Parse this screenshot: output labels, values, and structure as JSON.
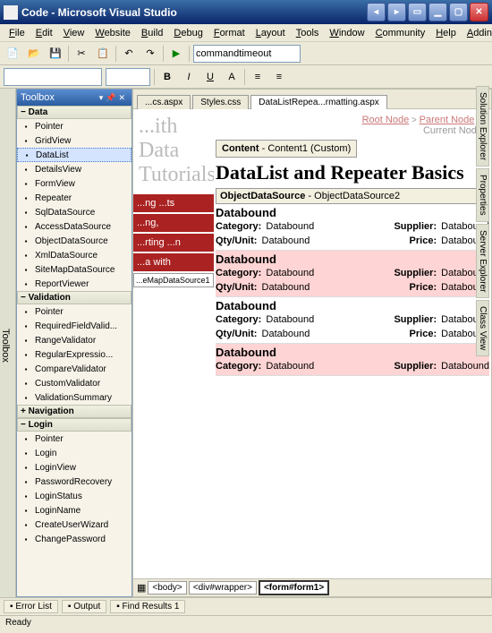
{
  "window": {
    "title": "Code - Microsoft Visual Studio",
    "min": "▁",
    "max": "▢",
    "close": "✕",
    "b1": "◂",
    "b2": "▸",
    "b3": "▭"
  },
  "menu": [
    "File",
    "Edit",
    "View",
    "Website",
    "Build",
    "Debug",
    "Format",
    "Layout",
    "Tools",
    "Window",
    "Community",
    "Help",
    "Addins"
  ],
  "quicklaunch": "commandtimeout",
  "side_tabs": [
    "Solution Explorer",
    "Properties",
    "Server Explorer",
    "Class View"
  ],
  "toolbox": {
    "title": "Toolbox",
    "cats": [
      {
        "name": "Data",
        "exp": "−",
        "items": [
          "Pointer",
          "GridView",
          "DataList",
          "DetailsView",
          "FormView",
          "Repeater",
          "SqlDataSource",
          "AccessDataSource",
          "ObjectDataSource",
          "XmlDataSource",
          "SiteMapDataSource",
          "ReportViewer"
        ],
        "selected": "DataList"
      },
      {
        "name": "Validation",
        "exp": "−",
        "items": [
          "Pointer",
          "RequiredFieldValid...",
          "RangeValidator",
          "RegularExpressio...",
          "CompareValidator",
          "CustomValidator",
          "ValidationSummary"
        ]
      },
      {
        "name": "Navigation",
        "exp": "+",
        "items": []
      },
      {
        "name": "Login",
        "exp": "−",
        "items": [
          "Pointer",
          "Login",
          "LoginView",
          "PasswordRecovery",
          "LoginStatus",
          "LoginName",
          "CreateUserWizard",
          "ChangePassword"
        ]
      }
    ]
  },
  "tabs": [
    {
      "label": "...cs.aspx",
      "active": false
    },
    {
      "label": "Styles.css",
      "active": false
    },
    {
      "label": "DataListRepea...rmatting.aspx",
      "active": true
    }
  ],
  "page": {
    "big_title": "...ith Data Tutorials",
    "bc": {
      "root": "Root Node",
      "parent": "Parent Node",
      "current": "Current Node"
    },
    "content_tag": {
      "b": "Content",
      "rest": " - Content1 (Custom)"
    },
    "h2": "DataList and Repeater Basics",
    "ods_tag": {
      "b": "ObjectDataSource",
      "rest": " - ObjectDataSource2"
    },
    "reds": [
      "...ng ...ts",
      "...ng,",
      "...rting ...n",
      "...a with"
    ],
    "footer_ctrl": "...eMapDataSource1",
    "labels": {
      "category": "Category:",
      "supplier": "Supplier:",
      "qty": "Qty/Unit:",
      "price": "Price:",
      "val": "Databound"
    }
  },
  "tagpath": [
    "<body>",
    "<div#wrapper>",
    "<form#form1>"
  ],
  "bottom_tabs": [
    "Error List",
    "Output",
    "Find Results 1"
  ],
  "status": "Ready"
}
